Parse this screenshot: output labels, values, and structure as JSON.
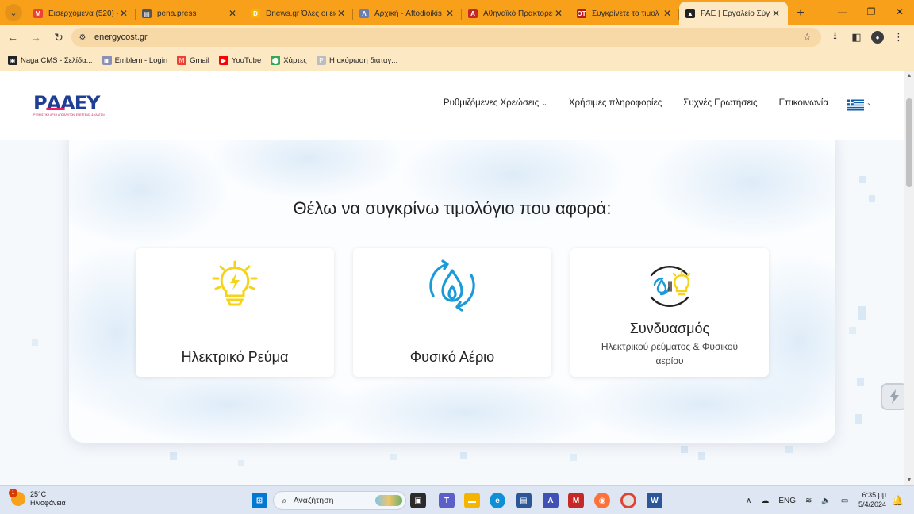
{
  "browser": {
    "tabs": [
      {
        "title": "Εισερχόμενα (520) -",
        "favicon": "gmail-icon",
        "color": "#ea4335",
        "glyph": "M",
        "active": false
      },
      {
        "title": "pena.press",
        "favicon": "newspaper-icon",
        "color": "#555555",
        "glyph": "▤",
        "active": false
      },
      {
        "title": "Dnews.gr Όλες οι ειδ",
        "favicon": "dnews-icon",
        "color": "#f6b400",
        "glyph": "D",
        "active": false
      },
      {
        "title": "Αρχική - Aftodioikis",
        "favicon": "aftodioikisi-icon",
        "color": "#6a7fb0",
        "glyph": "Λ",
        "active": false
      },
      {
        "title": "Αθηναϊκό Πρακτορεί",
        "favicon": "ana-icon",
        "color": "#c62828",
        "glyph": "A",
        "active": false
      },
      {
        "title": "Συγκρίνετε το τιμολ",
        "favicon": "ot-icon",
        "color": "#b71c1c",
        "glyph": "OT",
        "active": false
      },
      {
        "title": "PAE | Εργαλείο Σύγκρ",
        "favicon": "rae-icon",
        "color": "#222222",
        "glyph": "▲",
        "active": true
      }
    ],
    "new_tab_glyph": "+",
    "url": "energycost.gr",
    "bookmarks": [
      {
        "label": "Naga CMS - Σελίδα...",
        "icon": "naga-icon",
        "color": "#222222",
        "glyph": "◉"
      },
      {
        "label": "Emblem - Login",
        "icon": "emblem-icon",
        "color": "#8a8fb3",
        "glyph": "▣"
      },
      {
        "label": "Gmail",
        "icon": "gmail-icon",
        "color": "#ea4335",
        "glyph": "M"
      },
      {
        "label": "YouTube",
        "icon": "youtube-icon",
        "color": "#ff0000",
        "glyph": "▶"
      },
      {
        "label": "Χάρτες",
        "icon": "maps-icon",
        "color": "#34a853",
        "glyph": "⬤"
      },
      {
        "label": "Η ακύρωση διαταγ...",
        "icon": "doc-icon",
        "color": "#bdbdbd",
        "glyph": "P"
      }
    ]
  },
  "site": {
    "logo_text": "ΡΑΑΕΥ",
    "logo_tagline": "ΡΥΘΜΙΣΤΙΚΗ ΑΡΧΗ ΑΠΟΒΛΗΤΩΝ, ΕΝΕΡΓΕΙΑΣ & ΥΔΑΤΩΝ",
    "nav": [
      {
        "label": "Ρυθμιζόμενες Χρεώσεις",
        "has_caret": true
      },
      {
        "label": "Χρήσιμες πληροφορίες",
        "has_caret": false
      },
      {
        "label": "Συχνές Ερωτήσεις",
        "has_caret": false
      },
      {
        "label": "Επικοινωνία",
        "has_caret": false
      }
    ],
    "heading": "Θέλω να συγκρίνω τιμολόγιο που αφορά:",
    "cards": [
      {
        "title": "Ηλεκτρικό Ρεύμα",
        "subtitle": "",
        "icon": "lightbulb-icon"
      },
      {
        "title": "Φυσικό Αέριο",
        "subtitle": "",
        "icon": "gas-flame-icon"
      },
      {
        "title": "Συνδυασμός",
        "subtitle": "Ηλεκτρικού ρεύματος & Φυσικού αερίου",
        "icon": "combined-energy-icon"
      }
    ],
    "colors": {
      "brand_blue": "#1f3f94",
      "accent_pink": "#e91e63",
      "electric_yellow": "#f5d319",
      "gas_blue": "#1a9bd7"
    }
  },
  "taskbar": {
    "temperature": "25°C",
    "weather": "Ηλιοφάνεια",
    "weather_badge": "1",
    "search_placeholder": "Αναζήτηση",
    "language": "ENG",
    "time": "6:35 μμ",
    "date": "5/4/2024"
  }
}
